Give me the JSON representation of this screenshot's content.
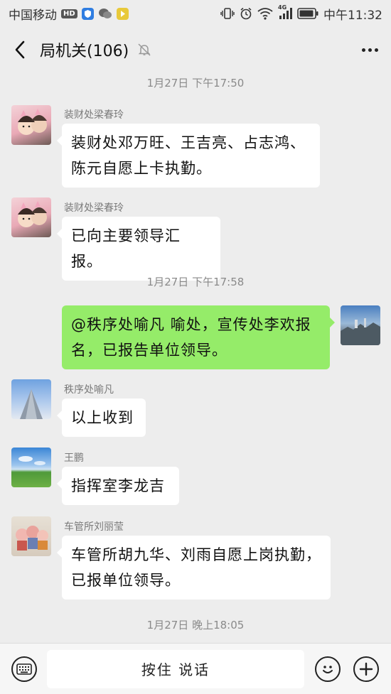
{
  "status_bar": {
    "carrier": "中国移动",
    "hd_badge": "HD",
    "network_badge": "4G",
    "time": "中午11:32"
  },
  "header": {
    "title": "局机关(106)"
  },
  "timestamps": [
    "1月27日 下午17:50",
    "1月27日 下午17:58",
    "1月27日 晚上18:05"
  ],
  "messages": [
    {
      "sender": "装财处梁春玲",
      "lines": [
        "装财处邓万旺、王吉亮、占志鸿、",
        "陈元自愿上卡执勤。"
      ]
    },
    {
      "sender": "装财处梁春玲",
      "lines": [
        "已向主要领导汇报。"
      ]
    },
    {
      "sender": "",
      "lines": [
        "@秩序处喻凡  喻处，宣传处李欢报",
        "名，已报告单位领导。"
      ]
    },
    {
      "sender": "秩序处喻凡",
      "lines": [
        "以上收到"
      ]
    },
    {
      "sender": "王鹏",
      "lines": [
        "指挥室李龙吉"
      ]
    },
    {
      "sender": "车管所刘丽莹",
      "lines": [
        "车管所胡九华、刘雨自愿上岗执勤，",
        "已报单位领导。"
      ]
    }
  ],
  "bottom_bar": {
    "voice_label": "按住 说话"
  },
  "colors": {
    "self_bubble": "#95ec69",
    "other_bubble": "#ffffff",
    "background": "#ededed"
  },
  "icons": [
    "back-arrow-icon",
    "mute-bell-icon",
    "more-icon",
    "keyboard-icon",
    "emoji-icon",
    "plus-icon"
  ]
}
